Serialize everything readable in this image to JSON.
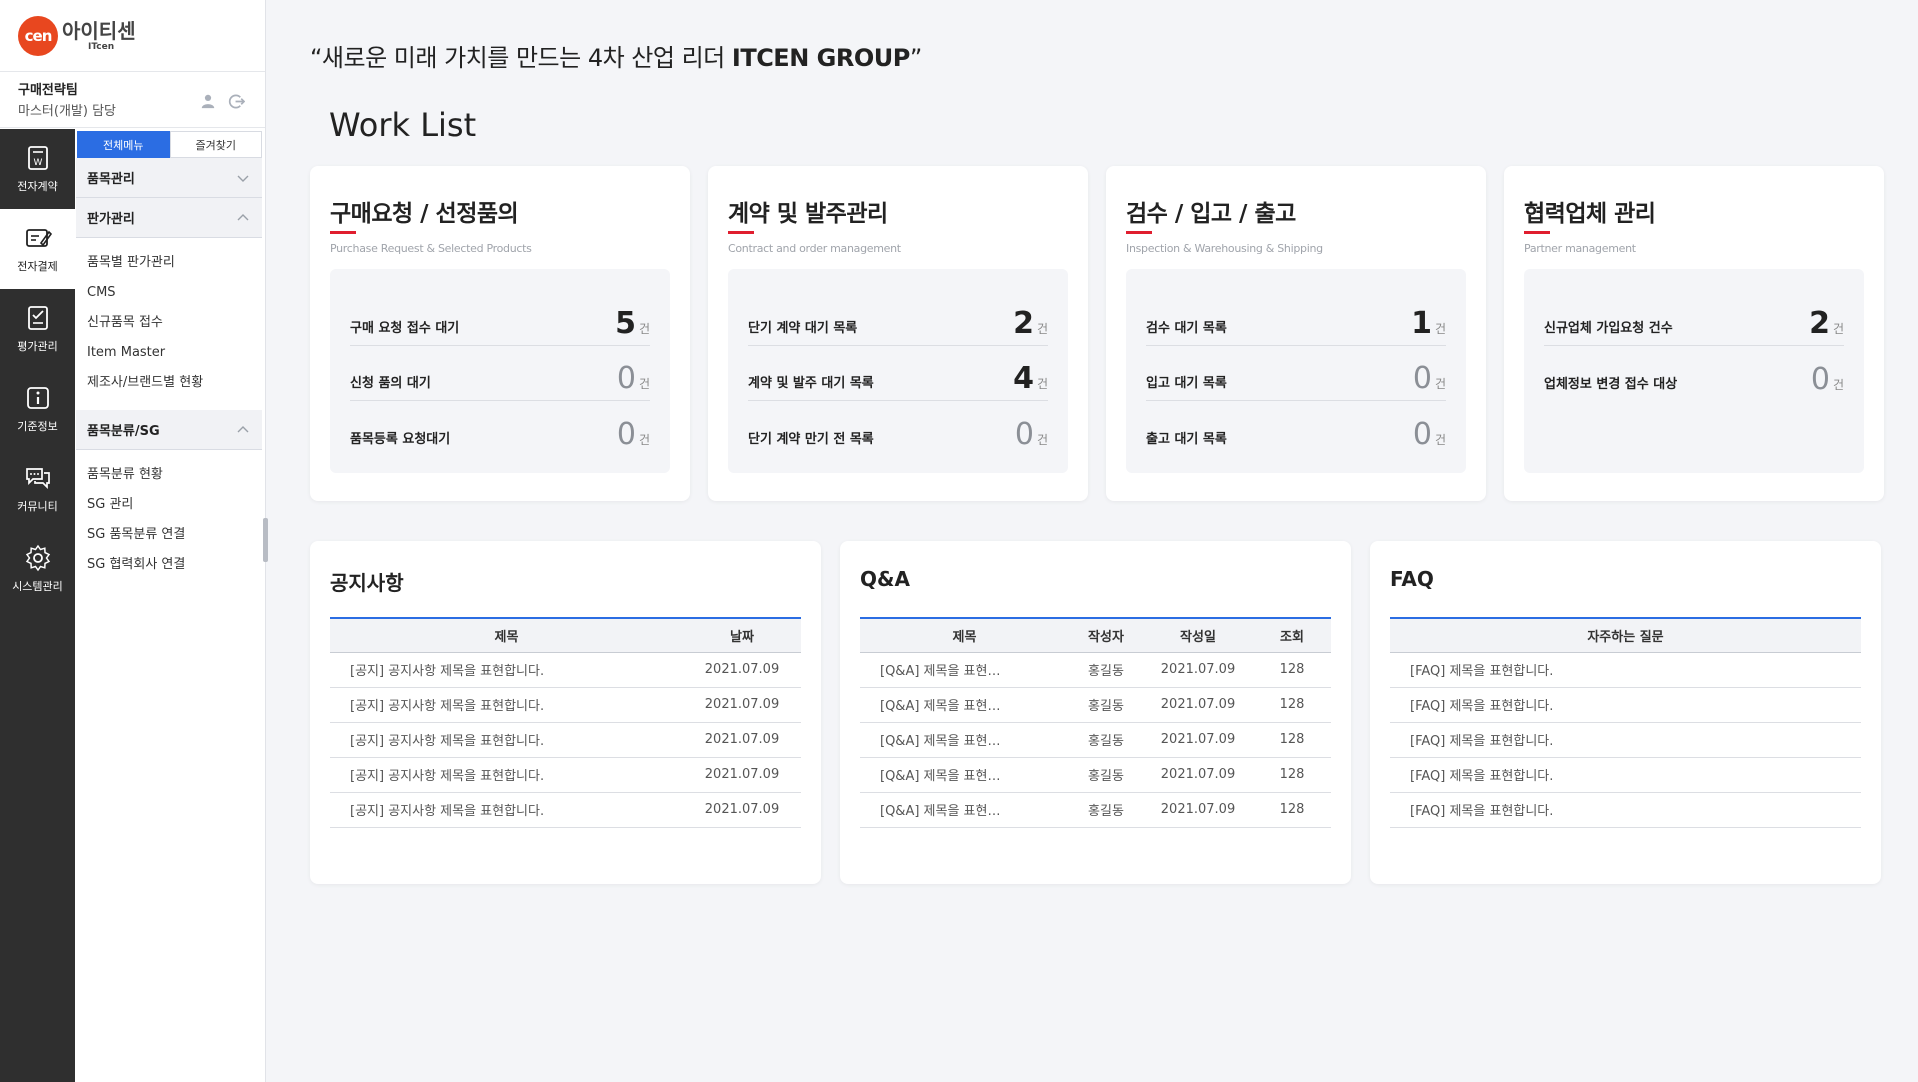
{
  "brand": {
    "mark": "cen",
    "name_kr": "아이티센",
    "name_en": "ITcen",
    "mark_color": "#e8471f"
  },
  "user": {
    "team": "구매전략팀",
    "role": "마스터(개발) 담당",
    "icons": [
      "user-icon",
      "logout-icon"
    ]
  },
  "rail": [
    {
      "label": "전자계약",
      "icon": "contract-icon"
    },
    {
      "label": "전자결제",
      "icon": "payment-icon"
    },
    {
      "label": "평가관리",
      "icon": "evaluation-icon"
    },
    {
      "label": "기준정보",
      "icon": "info-icon"
    },
    {
      "label": "커뮤니티",
      "icon": "chat-icon"
    },
    {
      "label": "시스템관리",
      "icon": "gear-icon"
    }
  ],
  "menu": {
    "tabs": [
      "전체메뉴",
      "즐겨찾기"
    ],
    "groups": [
      {
        "label": "품목관리",
        "expanded": false,
        "items": []
      },
      {
        "label": "판가관리",
        "expanded": true,
        "items": [
          "품목별 판가관리",
          "CMS",
          "신규품목 접수",
          "Item Master",
          "제조사/브랜드별 현황"
        ]
      },
      {
        "label": "품목분류/SG",
        "expanded": true,
        "items": [
          "품목분류 현황",
          "SG 관리",
          "SG 품목분류 연결",
          "SG 협력회사 연결"
        ]
      }
    ]
  },
  "slogan": {
    "prefix": "“새로운 미래 가치를 만드는 4차 산업 리더 ",
    "brand": "ITCEN GROUP",
    "suffix": "”"
  },
  "worklist": {
    "title": "Work List",
    "unit": "건",
    "cards": [
      {
        "title": "구매요청 / 선정품의",
        "subtitle": "Purchase Request & Selected Products",
        "rows": [
          {
            "label": "구매 요청 접수 대기",
            "value": "5"
          },
          {
            "label": "신청 품의 대기",
            "value": "0"
          },
          {
            "label": "품목등록 요청대기",
            "value": "0"
          }
        ]
      },
      {
        "title": "계약 및 발주관리",
        "subtitle": "Contract and order management",
        "rows": [
          {
            "label": "단기 계약 대기 목록",
            "value": "2"
          },
          {
            "label": "계약 및 발주 대기 목록",
            "value": "4"
          },
          {
            "label": "단기 계약 만기 전 목록",
            "value": "0"
          }
        ]
      },
      {
        "title": "검수 / 입고 / 출고",
        "subtitle": "Inspection & Warehousing & Shipping",
        "rows": [
          {
            "label": "검수 대기 목록",
            "value": "1"
          },
          {
            "label": "입고 대기 목록",
            "value": "0"
          },
          {
            "label": "출고 대기 목록",
            "value": "0"
          }
        ]
      },
      {
        "title": "협력업체 관리",
        "subtitle": "Partner management",
        "rows": [
          {
            "label": "신규업체 가입요청 건수",
            "value": "2"
          },
          {
            "label": "업체정보 변경 접수 대상",
            "value": "0"
          }
        ]
      }
    ]
  },
  "notice": {
    "title": "공지사항",
    "headers": [
      "제목",
      "날짜"
    ],
    "rows": [
      [
        "[공지] 공지사항 제목을 표현합니다.",
        "2021.07.09"
      ],
      [
        "[공지] 공지사항 제목을 표현합니다.",
        "2021.07.09"
      ],
      [
        "[공지] 공지사항 제목을 표현합니다.",
        "2021.07.09"
      ],
      [
        "[공지] 공지사항 제목을 표현합니다.",
        "2021.07.09"
      ],
      [
        "[공지] 공지사항 제목을 표현합니다.",
        "2021.07.09"
      ]
    ]
  },
  "qna": {
    "title": "Q&A",
    "headers": [
      "제목",
      "작성자",
      "작성일",
      "조회"
    ],
    "rows": [
      [
        "[Q&A] 제목을 표현…",
        "홍길동",
        "2021.07.09",
        "128"
      ],
      [
        "[Q&A] 제목을 표현…",
        "홍길동",
        "2021.07.09",
        "128"
      ],
      [
        "[Q&A] 제목을 표현…",
        "홍길동",
        "2021.07.09",
        "128"
      ],
      [
        "[Q&A] 제목을 표현…",
        "홍길동",
        "2021.07.09",
        "128"
      ],
      [
        "[Q&A] 제목을 표현…",
        "홍길동",
        "2021.07.09",
        "128"
      ]
    ]
  },
  "faq": {
    "title": "FAQ",
    "headers": [
      "자주하는 질문"
    ],
    "rows": [
      [
        "[FAQ] 제목을 표현합니다."
      ],
      [
        "[FAQ] 제목을 표현합니다."
      ],
      [
        "[FAQ] 제목을 표현합니다."
      ],
      [
        "[FAQ] 제목을 표현합니다."
      ],
      [
        "[FAQ] 제목을 표현합니다."
      ]
    ]
  },
  "colors": {
    "accent": "#2b6de3",
    "title_underline": "#e01e2f",
    "rail_bg": "#2f2f2f",
    "page_bg": "#f4f5f8"
  }
}
